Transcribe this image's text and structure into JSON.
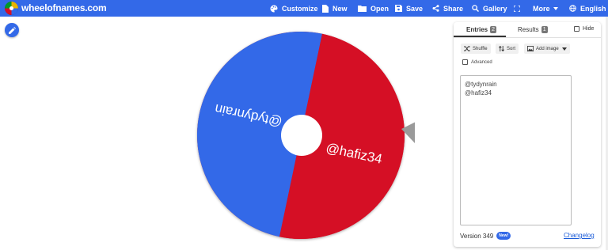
{
  "header": {
    "brand": "wheelofnames.com",
    "nav": [
      {
        "label": "Customize",
        "icon": "palette-icon"
      },
      {
        "label": "New",
        "icon": "file-icon"
      },
      {
        "label": "Open",
        "icon": "folder-icon"
      },
      {
        "label": "Save",
        "icon": "save-icon"
      },
      {
        "label": "Share",
        "icon": "share-icon"
      },
      {
        "label": "Gallery",
        "icon": "search-icon"
      },
      {
        "label": "",
        "icon": "fullscreen-icon"
      },
      {
        "label": "More",
        "icon": "chevron-down-icon"
      },
      {
        "label": "English",
        "icon": "globe-icon"
      }
    ]
  },
  "wheel": {
    "segments": [
      {
        "label": "@tydynrain",
        "color": "#3369e8"
      },
      {
        "label": "@hafiz34",
        "color": "#d50f25"
      }
    ]
  },
  "panel": {
    "tabs": [
      {
        "label": "Entries",
        "count": "2"
      },
      {
        "label": "Results",
        "count": "1"
      }
    ],
    "hide_label": "Hide",
    "toolbar": {
      "shuffle": "Shuffle",
      "sort": "Sort",
      "add_image": "Add image"
    },
    "advanced_label": "Advanced",
    "entries": [
      "@tydynrain",
      "@hafiz34"
    ],
    "version": "Version 349",
    "new_badge": "New!",
    "changelog": "Changelog"
  },
  "colors": {
    "brand_blue": "#3369e8",
    "wheel_red": "#d50f25"
  }
}
